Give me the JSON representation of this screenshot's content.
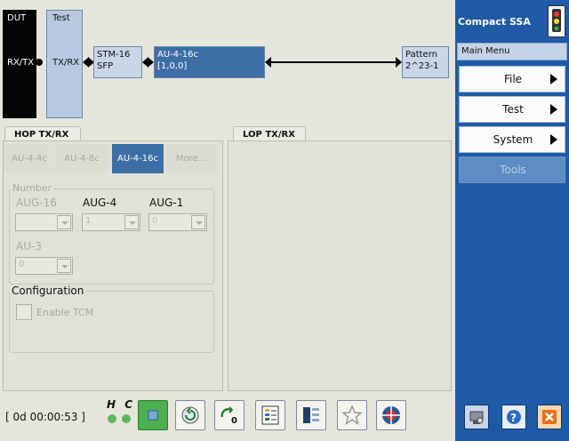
{
  "diagram": {
    "dut": {
      "title": "DUT",
      "port": "RX/TX"
    },
    "test": {
      "title": "Test",
      "port": "TX/RX"
    },
    "stm": {
      "line1": "STM-16",
      "line2": "SFP"
    },
    "au": {
      "line1": "AU-4-16c",
      "line2": "[1,0,0]"
    },
    "pattern": {
      "line1": "Pattern",
      "line2": "2^23-1"
    }
  },
  "hop": {
    "tab_label": "HOP TX/RX",
    "subtabs": [
      {
        "label": "AU-4-4c",
        "selected": false
      },
      {
        "label": "AU-4-8c",
        "selected": false
      },
      {
        "label": "AU-4-16c",
        "selected": true
      },
      {
        "label": "More...",
        "selected": false
      }
    ],
    "number": {
      "legend": "Number",
      "aug16_label": "AUG-16",
      "aug4_label": "AUG-4",
      "aug1_label": "AUG-1",
      "au3_label": "AU-3",
      "aug16_value": "",
      "aug4_value": "1",
      "aug1_value": "0",
      "au3_value": "0"
    },
    "configuration": {
      "legend": "Configuration",
      "enable_tcm_label": "Enable TCM"
    }
  },
  "lop": {
    "tab_label": "LOP TX/RX"
  },
  "status": {
    "timer": "[ 0d 00:00:53 ]",
    "hc_label": "H C"
  },
  "sidebar": {
    "title": "Compact SSA",
    "menu_header": "Main Menu",
    "items": [
      {
        "label": "File",
        "has_submenu": true
      },
      {
        "label": "Test",
        "has_submenu": true
      },
      {
        "label": "System",
        "has_submenu": true
      },
      {
        "label": "Tools",
        "has_submenu": false
      }
    ]
  },
  "toolbar_icons": [
    "stop-icon",
    "reset-icon",
    "zero-icon",
    "report-icon",
    "layout-icon",
    "favorite-icon",
    "global-icon"
  ],
  "side_icons": [
    "settings-icon",
    "help-icon",
    "close-icon"
  ],
  "colors": {
    "accent": "#3d6ea6",
    "sidebar": "#1f5aa6",
    "led": "#5cb85c",
    "close": "#e8701a"
  }
}
